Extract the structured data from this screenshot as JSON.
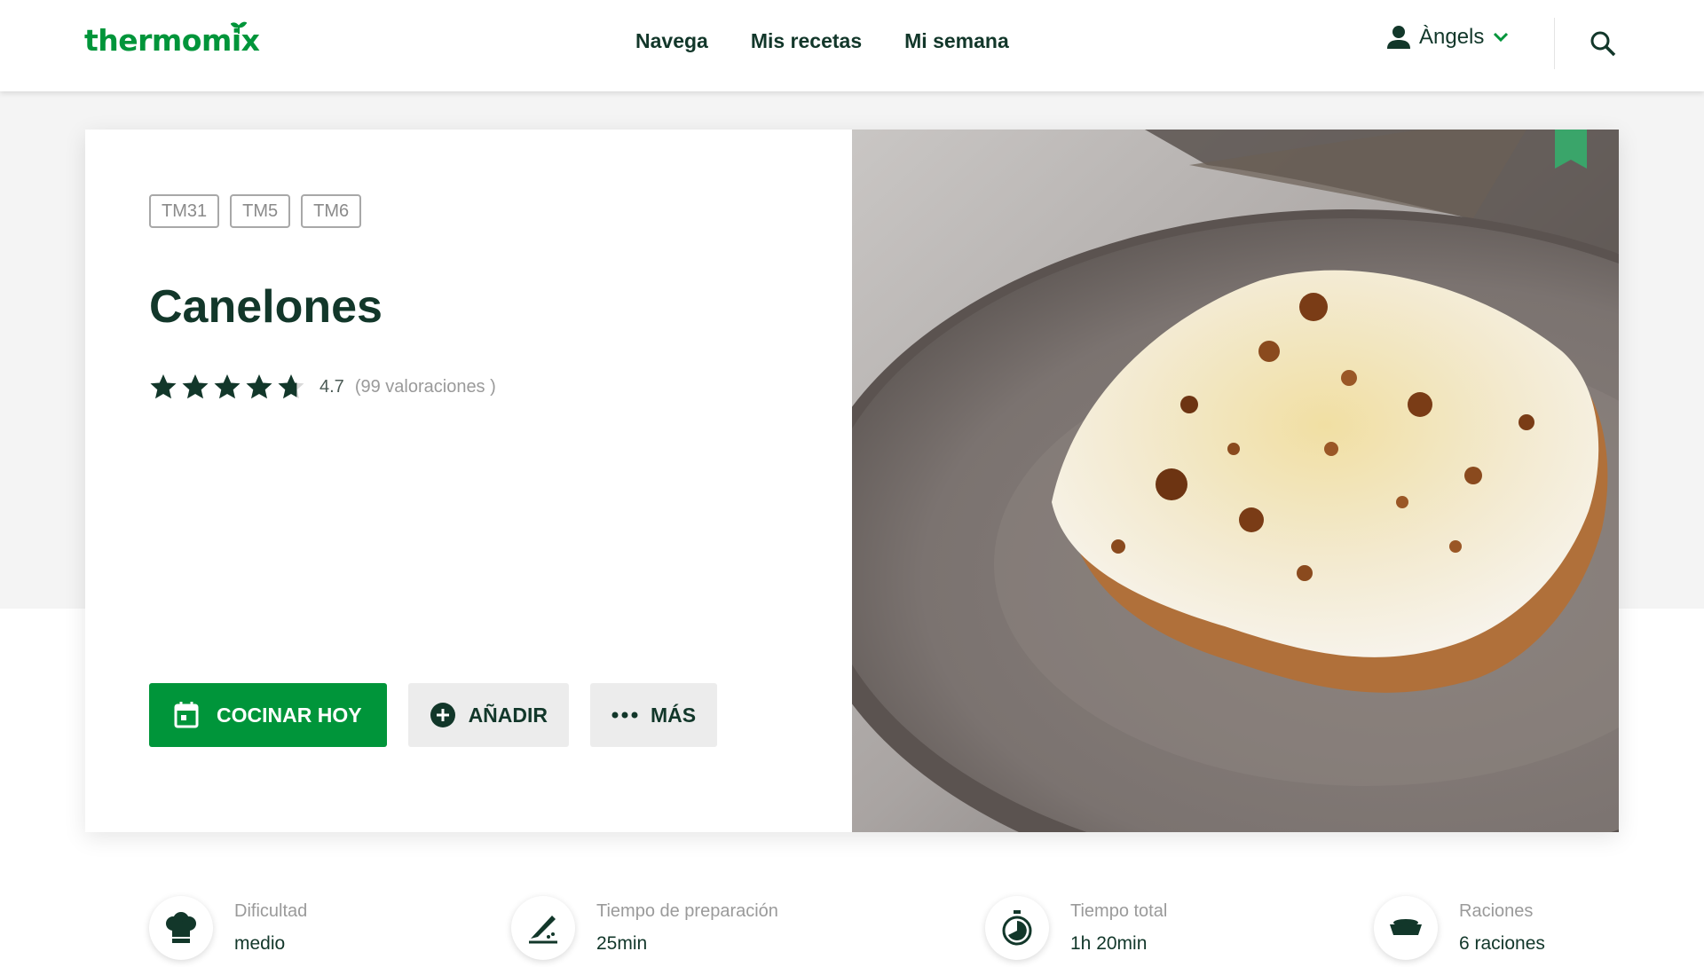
{
  "header": {
    "logo_text": "thermomix",
    "nav": [
      "Navega",
      "Mis recetas",
      "Mi semana"
    ],
    "user_name": "Àngels"
  },
  "recipe": {
    "compat_tags": [
      "TM31",
      "TM5",
      "TM6"
    ],
    "title": "Canelones",
    "rating_value": "4.7",
    "rating_stars": 4.7,
    "rating_count": "(99 valoraciones )",
    "actions": {
      "cook_today": "COCINAR HOY",
      "add": "AÑADIR",
      "more": "MÁS"
    },
    "info": [
      {
        "label": "Dificultad",
        "value": "medio",
        "icon": "chef-hat-icon"
      },
      {
        "label": "Tiempo de preparación",
        "value": "25min",
        "icon": "knife-icon"
      },
      {
        "label": "Tiempo total",
        "value": "1h 20min",
        "icon": "timer-icon"
      },
      {
        "label": "Raciones",
        "value": "6 raciones",
        "icon": "dish-icon"
      }
    ]
  },
  "colors": {
    "brand_green": "#00953a",
    "dark_text": "#12372a",
    "background_band": "#f4f4f4"
  }
}
